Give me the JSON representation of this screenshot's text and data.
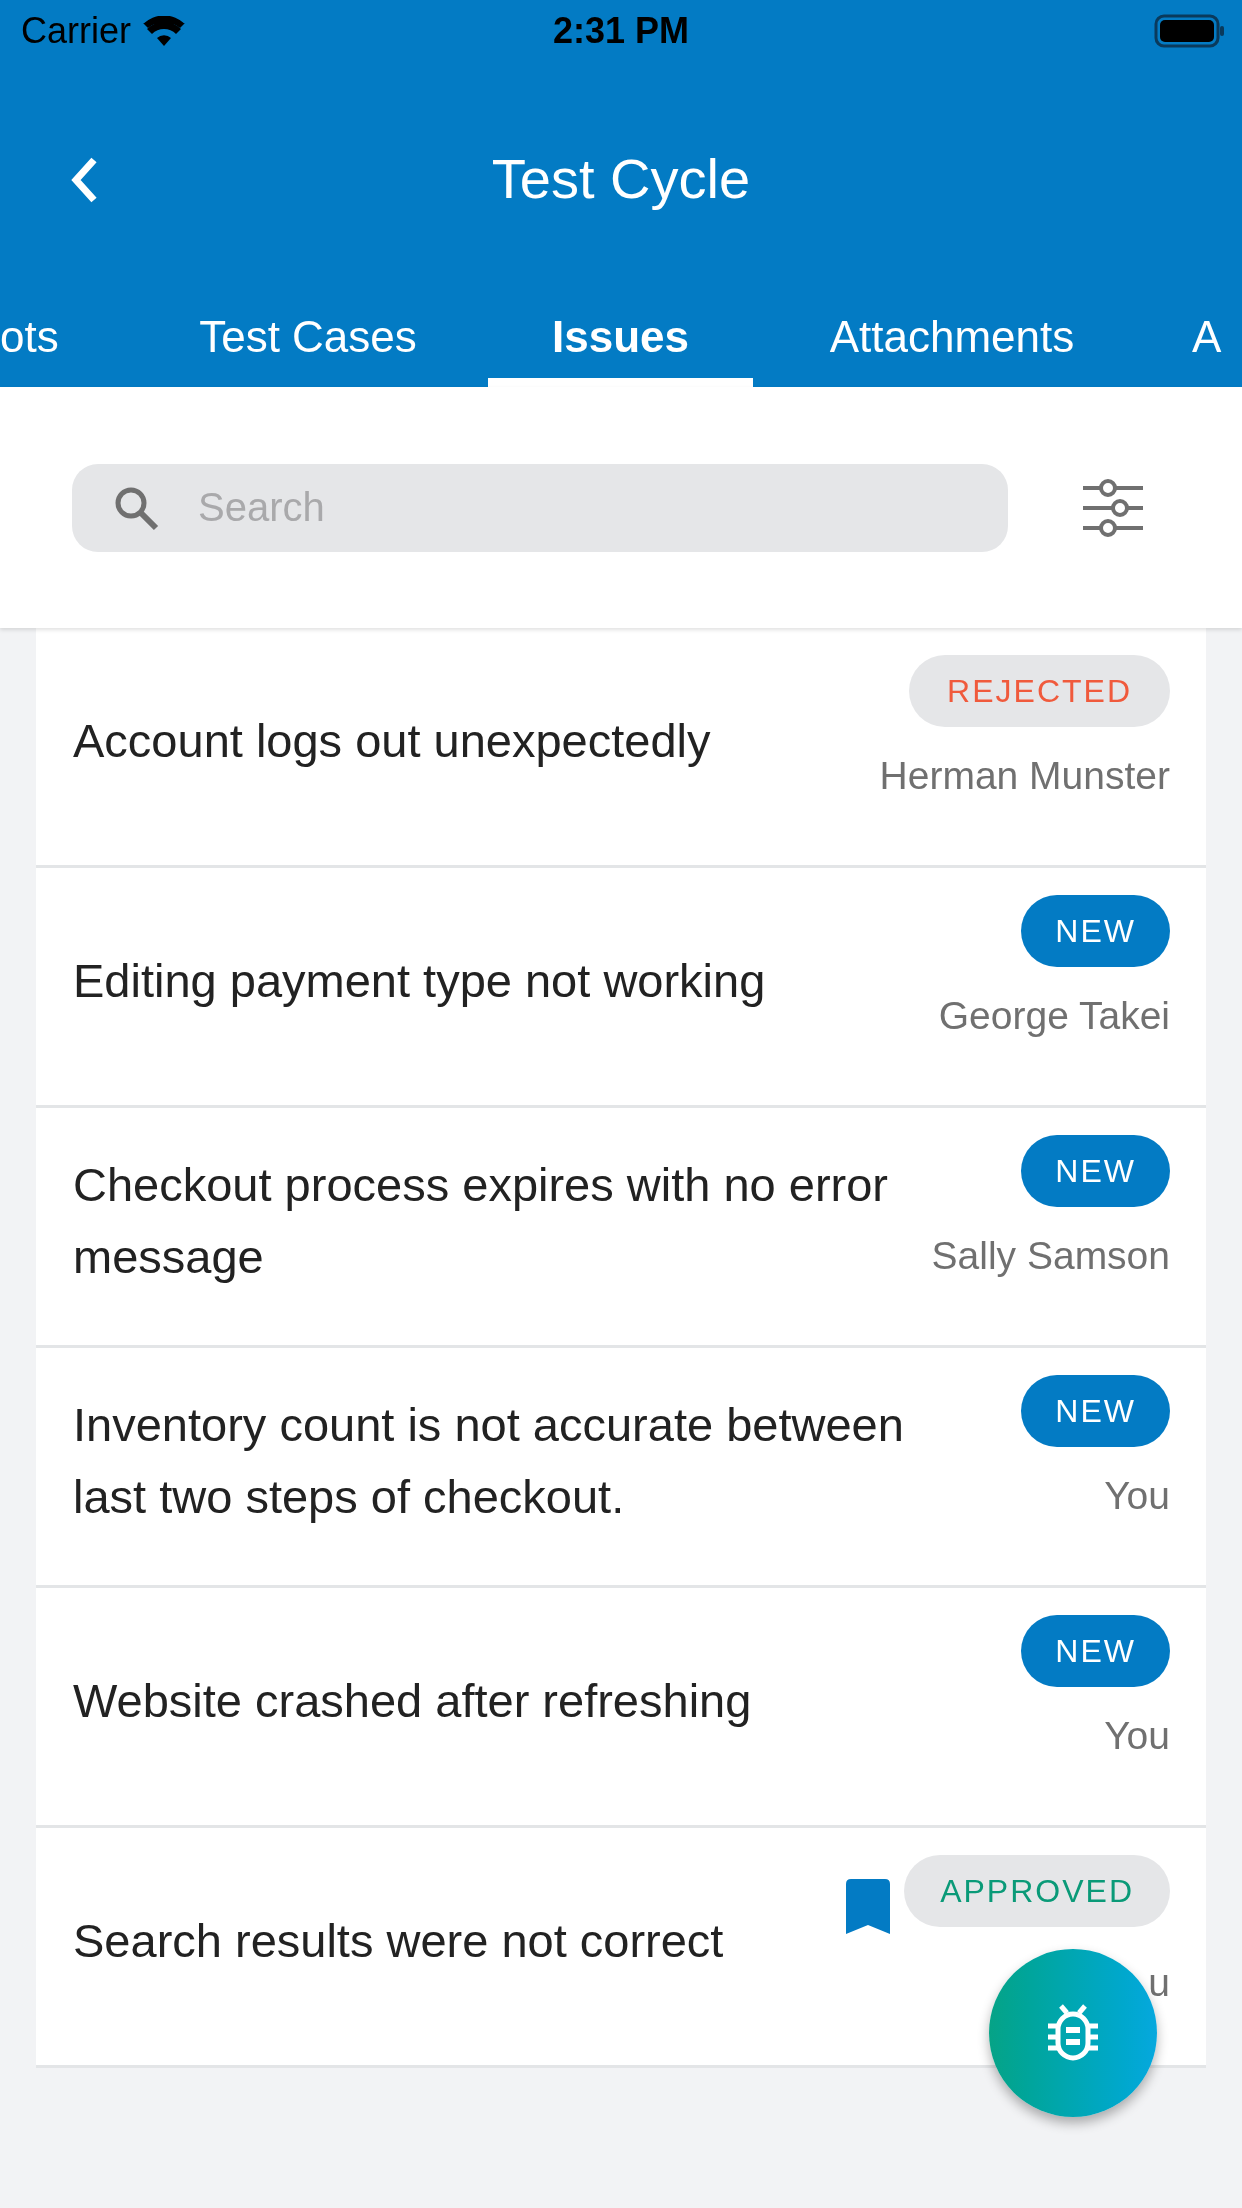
{
  "status_bar": {
    "carrier": "Carrier",
    "time": "2:31 PM"
  },
  "nav": {
    "title": "Test Cycle"
  },
  "tabs": [
    {
      "label": "ots",
      "selected": false
    },
    {
      "label": "Test Cases",
      "selected": false
    },
    {
      "label": "Issues",
      "selected": true
    },
    {
      "label": "Attachments",
      "selected": false
    },
    {
      "label": "A",
      "selected": false
    }
  ],
  "search": {
    "placeholder": "Search"
  },
  "issues": [
    {
      "title": "Account logs out unexpectedly",
      "status": {
        "label": "REJECTED",
        "kind": "rejected"
      },
      "author": "Herman Munster",
      "bookmarked": false
    },
    {
      "title": "Editing payment type not working",
      "status": {
        "label": "NEW",
        "kind": "new"
      },
      "author": "George Takei",
      "bookmarked": false
    },
    {
      "title": "Checkout process expires with no error message",
      "status": {
        "label": "NEW",
        "kind": "new"
      },
      "author": "Sally Samson",
      "bookmarked": false
    },
    {
      "title": "Inventory count is not accurate between last two steps of checkout.",
      "status": {
        "label": "NEW",
        "kind": "new"
      },
      "author": "You",
      "bookmarked": false
    },
    {
      "title": "Website crashed after refreshing",
      "status": {
        "label": "NEW",
        "kind": "new"
      },
      "author": "You",
      "bookmarked": false
    },
    {
      "title": "Search results were not correct",
      "status": {
        "label": "APPROVED",
        "kind": "approved"
      },
      "author": "u",
      "bookmarked": true
    }
  ]
}
